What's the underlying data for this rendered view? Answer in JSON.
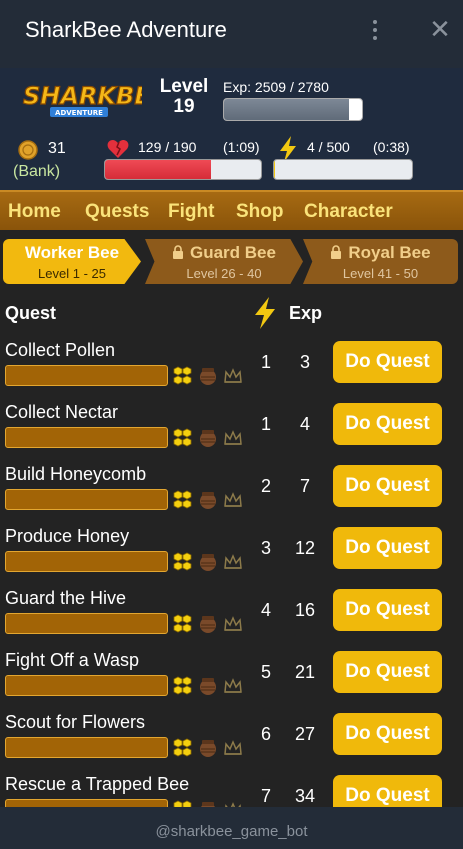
{
  "window": {
    "title": "SharkBee Adventure",
    "menu_icon": "more-vertical-icon",
    "close_icon": "close-icon",
    "close_glyph": "✕"
  },
  "stats": {
    "logo_text": "SHARKBEE",
    "logo_subtext": "ADVENTURE",
    "level_label": "Level",
    "level_value": "19",
    "exp_text": "Exp: 2509 / 2780",
    "exp_fraction": 0.9025,
    "gold": "31",
    "bank_label": "(Bank)",
    "hp_text": "129 / 190",
    "hp_timer": "(1:09)",
    "hp_fraction": 0.679,
    "energy_text": "4 / 500",
    "energy_timer": "(0:38)",
    "energy_fraction": 0.008
  },
  "nav": [
    "Home",
    "Quests",
    "Fight",
    "Shop",
    "Character"
  ],
  "tiers": [
    {
      "name": "Worker Bee",
      "range": "Level 1 - 25",
      "locked": false
    },
    {
      "name": "Guard Bee",
      "range": "Level 26 - 40",
      "locked": true
    },
    {
      "name": "Royal Bee",
      "range": "Level 41 - 50",
      "locked": true
    }
  ],
  "table": {
    "col_quest": "Quest",
    "col_exp": "Exp"
  },
  "quests": [
    {
      "name": "Collect Pollen",
      "energy": "1",
      "exp": "3",
      "button": "Do Quest"
    },
    {
      "name": "Collect Nectar",
      "energy": "1",
      "exp": "4",
      "button": "Do Quest"
    },
    {
      "name": "Build Honeycomb",
      "energy": "2",
      "exp": "7",
      "button": "Do Quest"
    },
    {
      "name": "Produce Honey",
      "energy": "3",
      "exp": "12",
      "button": "Do Quest"
    },
    {
      "name": "Guard the Hive",
      "energy": "4",
      "exp": "16",
      "button": "Do Quest"
    },
    {
      "name": "Fight Off a Wasp",
      "energy": "5",
      "exp": "21",
      "button": "Do Quest"
    },
    {
      "name": "Scout for Flowers",
      "energy": "6",
      "exp": "27",
      "button": "Do Quest"
    },
    {
      "name": "Rescue a Trapped Bee",
      "energy": "7",
      "exp": "34",
      "button": "Do Quest"
    }
  ],
  "footer": {
    "bot_handle": "@sharkbee_game_bot"
  },
  "colors": {
    "accent": "#f0b90b",
    "nav_bg": "#8a540a",
    "header_bg": "#1f2b3e",
    "hp": "#d62c38",
    "progress": "#a26406"
  }
}
